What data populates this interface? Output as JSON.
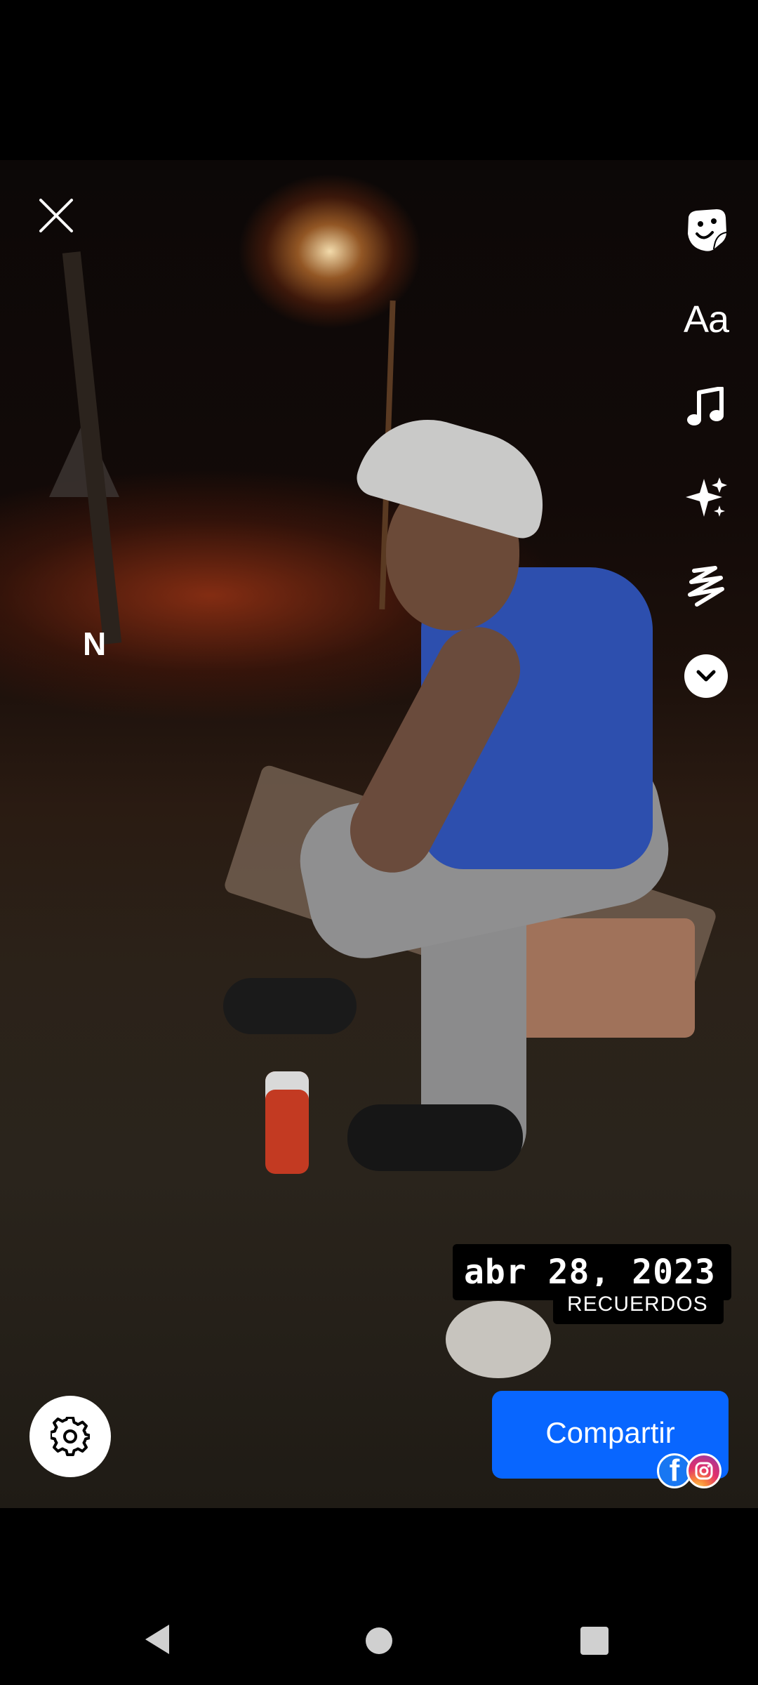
{
  "photo": {
    "overlay_letter": "N"
  },
  "toolbar": {
    "text_tool_label": "Aa",
    "icons": [
      "sticker-icon",
      "text-icon",
      "music-icon",
      "effects-icon",
      "doodle-icon",
      "more-chevron-icon"
    ]
  },
  "memory": {
    "date": "abr 28, 2023",
    "label": "RECUERDOS"
  },
  "share": {
    "label": "Compartir",
    "targets": [
      "facebook-icon",
      "instagram-icon"
    ]
  },
  "colors": {
    "share_button": "#0866ff",
    "facebook": "#1877f2",
    "background": "#000000"
  },
  "navigation": {
    "buttons": [
      "back-icon",
      "home-icon",
      "recents-icon"
    ]
  }
}
